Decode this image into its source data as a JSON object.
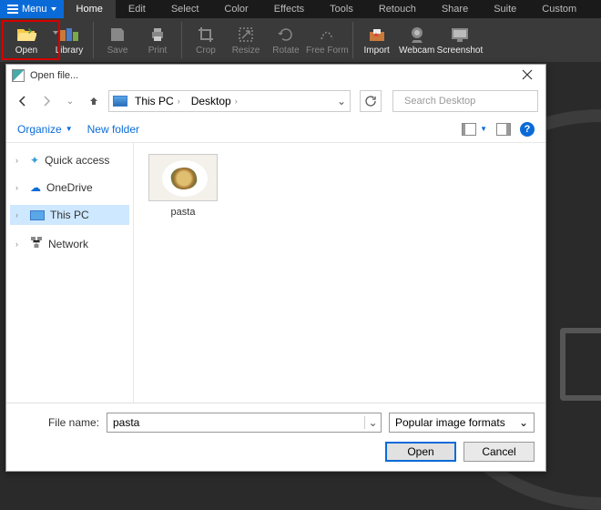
{
  "menubar": {
    "menu_label": "Menu",
    "tabs": [
      "Home",
      "Edit",
      "Select",
      "Color",
      "Effects",
      "Tools",
      "Retouch",
      "Share",
      "Suite",
      "Custom"
    ],
    "active_index": 0
  },
  "ribbon": {
    "open": "Open",
    "library": "Library",
    "save": "Save",
    "print": "Print",
    "crop": "Crop",
    "resize": "Resize",
    "rotate": "Rotate",
    "freeform": "Free Form",
    "import": "Import",
    "webcam": "Webcam",
    "screenshot": "Screenshot"
  },
  "dialog": {
    "title": "Open file...",
    "breadcrumb": [
      "This PC",
      "Desktop"
    ],
    "search_placeholder": "Search Desktop",
    "organize": "Organize",
    "new_folder": "New folder",
    "tree": {
      "quick_access": "Quick access",
      "onedrive": "OneDrive",
      "this_pc": "This PC",
      "network": "Network"
    },
    "thumb_label": "pasta",
    "filename_label": "File name:",
    "filename_value": "pasta",
    "filter_label": "Popular image formats",
    "open_btn": "Open",
    "cancel_btn": "Cancel"
  }
}
